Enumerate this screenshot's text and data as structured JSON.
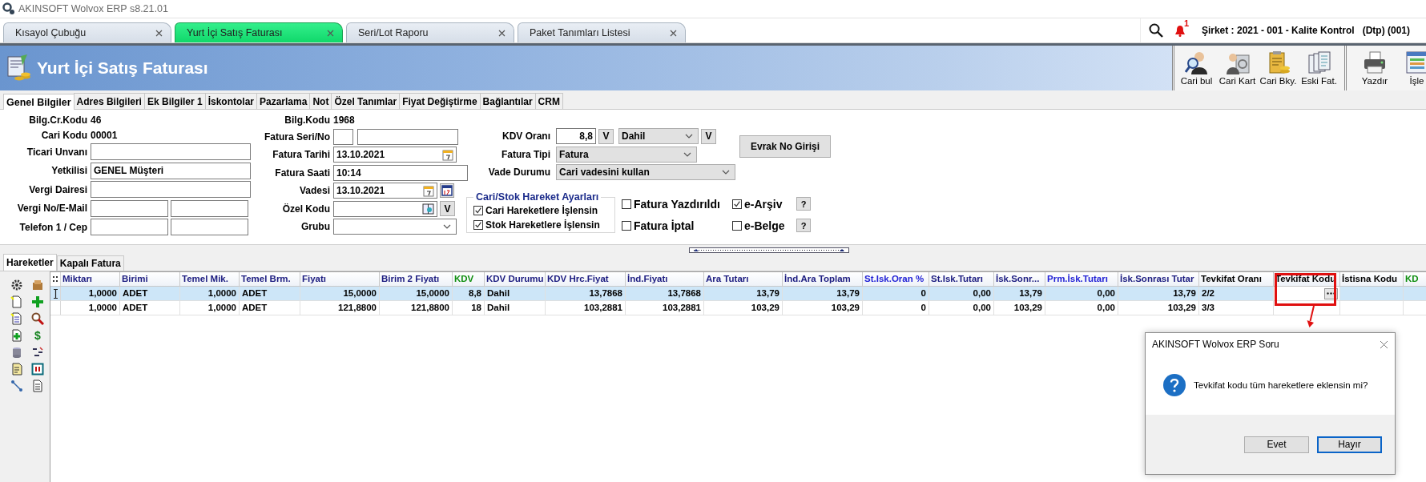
{
  "window": {
    "title": "AKINSOFT Wolvox ERP s8.21.01"
  },
  "tabs": [
    {
      "label": "Kısayol Çubuğu",
      "selected": false
    },
    {
      "label": "Yurt İçi Satış Faturası",
      "selected": true
    },
    {
      "label": "Seri/Lot Raporu",
      "selected": false
    },
    {
      "label": "Paket Tanımları Listesi",
      "selected": false
    }
  ],
  "status": {
    "notification_count": "1",
    "company": "Şirket : 2021 - 001 - Kalite Kontrol   (Dtp) (001)"
  },
  "header": {
    "title": "Yurt İçi Satış Faturası"
  },
  "toolbar": [
    {
      "label": "Cari bul",
      "kind": "find",
      "separator_before": false
    },
    {
      "label": "Cari Kart",
      "kind": "card",
      "separator_before": false
    },
    {
      "label": "Cari Bky.",
      "kind": "balance",
      "separator_before": false
    },
    {
      "label": "Eski Fat.",
      "kind": "invoices",
      "separator_before": false
    },
    {
      "label": "Yazdır",
      "kind": "print",
      "separator_before": true
    },
    {
      "label": "İşle",
      "kind": "process",
      "separator_before": false
    }
  ],
  "sub_tabs": [
    {
      "label": "Genel Bilgiler",
      "selected": true
    },
    {
      "label": "Adres Bilgileri",
      "selected": false
    },
    {
      "label": "Ek Bilgiler 1",
      "selected": false
    },
    {
      "label": "İskontolar",
      "selected": false
    },
    {
      "label": "Pazarlama",
      "selected": false
    },
    {
      "label": "Not",
      "selected": false
    },
    {
      "label": "Özel Tanımlar",
      "selected": false
    },
    {
      "label": "Fiyat Değiştirme",
      "selected": false
    },
    {
      "label": "Bağlantılar",
      "selected": false
    },
    {
      "label": "CRM",
      "selected": false
    }
  ],
  "form": {
    "left": {
      "info": [
        {
          "label": "Bilg.Cr.Kodu",
          "value": "46"
        },
        {
          "label": "Cari Kodu",
          "value": "00001"
        }
      ],
      "fields": [
        {
          "label": "Ticari Unvanı",
          "kind": "text"
        },
        {
          "label": "Yetkilisi",
          "kind": "text",
          "value": "GENEL Müşteri"
        },
        {
          "label": "Vergi Dairesi",
          "kind": "text"
        },
        {
          "label": "Vergi No/E-Mail",
          "kind": "pair"
        },
        {
          "label": "Telefon 1 / Cep",
          "kind": "pair"
        }
      ]
    },
    "middle": {
      "info": [
        {
          "label": "Bilg.Kodu",
          "value": "1968"
        }
      ],
      "fields": [
        {
          "label": "Fatura Seri/No",
          "kind": "serial"
        },
        {
          "label": "Fatura Tarihi",
          "kind": "date",
          "value": "13.10.2021"
        },
        {
          "label": "Fatura Saati",
          "kind": "text",
          "value": "10:14"
        },
        {
          "label": "Vadesi",
          "kind": "due_date",
          "value": "13.10.2021"
        },
        {
          "label": "Özel Kodu",
          "kind": "lookup",
          "button": "V"
        },
        {
          "label": "Grubu",
          "kind": "combo"
        }
      ]
    },
    "right": {
      "fields": [
        {
          "label": "KDV Oranı",
          "kind": "rate",
          "value": "8,8",
          "button": "V",
          "option": "Dahil",
          "option_button": "V"
        },
        {
          "label": "Fatura Tipi",
          "kind": "combo",
          "value": "Fatura"
        },
        {
          "label": "Vade Durumu",
          "kind": "wide_combo",
          "value": "Cari vadesini kullan"
        }
      ],
      "evrak_button": "Evrak No Girişi",
      "movement_settings": {
        "title": "Cari/Stok Hareket Ayarları",
        "options": [
          {
            "label": "Cari Hareketlere İşlensin",
            "checked": true
          },
          {
            "label": "Stok Hareketlere İşlensin",
            "checked": true
          }
        ]
      },
      "flags": [
        {
          "label": "Fatura Yazdırıldı",
          "checked": false
        },
        {
          "label": "e-Arşiv",
          "checked": true,
          "help": "?"
        },
        {
          "label": "Fatura İptal",
          "checked": false
        },
        {
          "label": "e-Belge",
          "checked": false,
          "help": "?"
        }
      ]
    }
  },
  "bottom_tabs": [
    {
      "label": "Hareketler",
      "selected": true
    },
    {
      "label": "Kapalı Fatura",
      "selected": false
    }
  ],
  "side_toolbar": {
    "currency_symbol": "$"
  },
  "grid": {
    "columns": [
      {
        "name": "Miktarı",
        "kind": "number",
        "color": "#1c1c80",
        "highlighted": false
      },
      {
        "name": "Birimi",
        "kind": "text",
        "color": "#1c1c80",
        "highlighted": false
      },
      {
        "name": "Temel Mik.",
        "kind": "number",
        "color": "#1c1c80",
        "highlighted": false
      },
      {
        "name": "Temel Brm.",
        "kind": "text",
        "color": "#1c1c80",
        "highlighted": false
      },
      {
        "name": "Fiyatı",
        "kind": "number",
        "color": "#1c1c80",
        "highlighted": false
      },
      {
        "name": "Birim 2 Fiyatı",
        "kind": "number",
        "color": "#1c1c80",
        "highlighted": false
      },
      {
        "name": "KDV",
        "kind": "number",
        "color": "#0f8f0f",
        "highlighted": false
      },
      {
        "name": "KDV Durumu",
        "kind": "text",
        "color": "#1c1c80",
        "highlighted": false
      },
      {
        "name": "KDV Hrc.Fiyat",
        "kind": "number",
        "color": "#1c1c80",
        "highlighted": false
      },
      {
        "name": "İnd.Fiyatı",
        "kind": "number",
        "color": "#1c1c80",
        "highlighted": false
      },
      {
        "name": "Ara Tutarı",
        "kind": "number",
        "color": "#1c1c80",
        "highlighted": false
      },
      {
        "name": "İnd.Ara Toplam",
        "kind": "number",
        "color": "#1c1c80",
        "highlighted": false
      },
      {
        "name": "St.Isk.Oran %",
        "kind": "number",
        "color": "#2222d6",
        "highlighted": false
      },
      {
        "name": "St.Isk.Tutarı",
        "kind": "number",
        "color": "#1c1c80",
        "highlighted": false
      },
      {
        "name": "İsk.Sonr...",
        "kind": "number",
        "color": "#1c1c80",
        "highlighted": false
      },
      {
        "name": "Prm.İsk.Tutarı",
        "kind": "number",
        "color": "#2222d6",
        "highlighted": false
      },
      {
        "name": "İsk.Sonrası Tutar",
        "kind": "number",
        "color": "#1c1c80",
        "highlighted": false
      },
      {
        "name": "Tevkifat Oranı",
        "kind": "text",
        "color": "#000000",
        "highlighted": false
      },
      {
        "name": "Tevkifat Kodu",
        "kind": "lookup",
        "color": "#000000",
        "highlighted": true
      },
      {
        "name": "İstisna Kodu",
        "kind": "text",
        "color": "#000000",
        "highlighted": false
      },
      {
        "name": "KD",
        "kind": "text",
        "color": "#0f8f0f",
        "highlighted": false
      }
    ],
    "rows": [
      {
        "selected": true,
        "editing": true,
        "cells": [
          "1,0000",
          "ADET",
          "1,0000",
          "ADET",
          "15,0000",
          "15,0000",
          "8,8",
          "Dahil",
          "13,7868",
          "13,7868",
          "13,79",
          "13,79",
          "0",
          "0,00",
          "13,79",
          "0,00",
          "13,79",
          "2/2"
        ]
      },
      {
        "selected": false,
        "editing": false,
        "cells": [
          "1,0000",
          "ADET",
          "1,0000",
          "ADET",
          "121,8800",
          "121,8800",
          "18",
          "Dahil",
          "103,2881",
          "103,2881",
          "103,29",
          "103,29",
          "0",
          "0,00",
          "103,29",
          "0,00",
          "103,29",
          "3/3"
        ]
      }
    ]
  },
  "dialog": {
    "title": "AKINSOFT Wolvox ERP Soru",
    "message": "Tevkifat kodu tüm hareketlere eklensin mi?",
    "buttons": [
      {
        "label": "Evet",
        "selected": false
      },
      {
        "label": "Hayır",
        "selected": true
      }
    ]
  }
}
